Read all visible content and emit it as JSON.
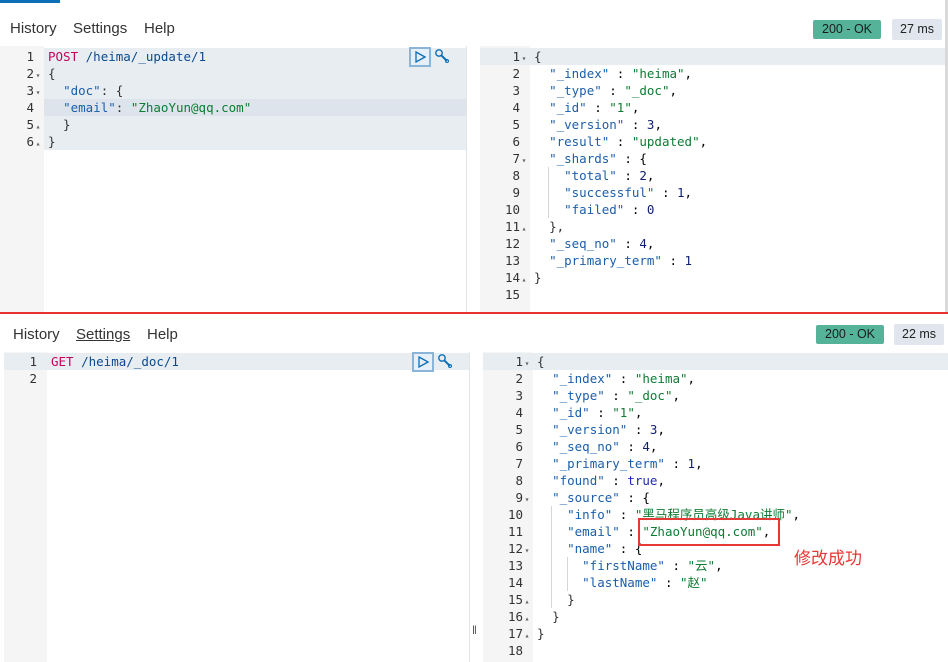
{
  "menu": {
    "history": "History",
    "settings": "Settings",
    "help": "Help"
  },
  "top": {
    "status": "200 - OK",
    "time": "27 ms",
    "request": {
      "line_numbers": [
        "1",
        "2",
        "3",
        "4",
        "5",
        "6"
      ],
      "method": "POST",
      "path": "/heima/_update/1",
      "line2": "{",
      "line3_key": "\"doc\"",
      "line3_rest": ": {",
      "line4_key": "\"email\"",
      "line4_colon": ": ",
      "line4_value": "\"ZhaoYun@qq.com\"",
      "line5": "  }",
      "line6": "}"
    },
    "response": {
      "line_numbers": [
        "1",
        "2",
        "3",
        "4",
        "5",
        "6",
        "7",
        "8",
        "9",
        "10",
        "11",
        "12",
        "13",
        "14",
        "15"
      ],
      "open_brace": "{",
      "index_key": "\"_index\"",
      "index_value": "\"heima\"",
      "type_key": "\"_type\"",
      "type_value": "\"_doc\"",
      "id_key": "\"_id\"",
      "id_value": "\"1\"",
      "version_key": "\"_version\"",
      "version_value": "3",
      "result_key": "\"result\"",
      "result_value": "\"updated\"",
      "shards_key": "\"_shards\"",
      "total_key": "\"total\"",
      "total_value": "2",
      "successful_key": "\"successful\"",
      "successful_value": "1",
      "failed_key": "\"failed\"",
      "failed_value": "0",
      "shards_close": "},",
      "seq_no_key": "\"_seq_no\"",
      "seq_no_value": "4",
      "primary_term_key": "\"_primary_term\"",
      "primary_term_value": "1",
      "close_brace": "}"
    }
  },
  "bottom": {
    "status": "200 - OK",
    "time": "22 ms",
    "request": {
      "line_numbers": [
        "1",
        "2"
      ],
      "method": "GET",
      "path": "/heima/_doc/1"
    },
    "response": {
      "line_numbers": [
        "1",
        "2",
        "3",
        "4",
        "5",
        "6",
        "7",
        "8",
        "9",
        "10",
        "11",
        "12",
        "13",
        "14",
        "15",
        "16",
        "17",
        "18"
      ],
      "open_brace": "{",
      "index_key": "\"_index\"",
      "index_value": "\"heima\"",
      "type_key": "\"_type\"",
      "type_value": "\"_doc\"",
      "id_key": "\"_id\"",
      "id_value": "\"1\"",
      "version_key": "\"_version\"",
      "version_value": "3",
      "seq_no_key": "\"_seq_no\"",
      "seq_no_value": "4",
      "primary_term_key": "\"_primary_term\"",
      "primary_term_value": "1",
      "found_key": "\"found\"",
      "found_value": "true",
      "source_key": "\"_source\"",
      "info_key": "\"info\"",
      "info_value": "\"黑马程序员高级Java讲师\"",
      "email_key": "\"email\"",
      "email_value": "\"ZhaoYun@qq.com\"",
      "name_key": "\"name\"",
      "first_name_key": "\"firstName\"",
      "first_name_value": "\"云\"",
      "last_name_key": "\"lastName\"",
      "last_name_value": "\"赵\"",
      "name_close": "}",
      "source_close": "}",
      "close_brace": "}"
    }
  },
  "annotation": {
    "text": "修改成功",
    "color": "#e53935"
  },
  "colors": {
    "status_ok": "#54b399",
    "divider": "#e8322d",
    "method": "#c3065e",
    "string": "#0f7b33",
    "key": "#1b5eaa"
  },
  "icons": [
    "play-icon",
    "wrench-icon",
    "fold-arrow-icon",
    "resize-handle-icon"
  ]
}
